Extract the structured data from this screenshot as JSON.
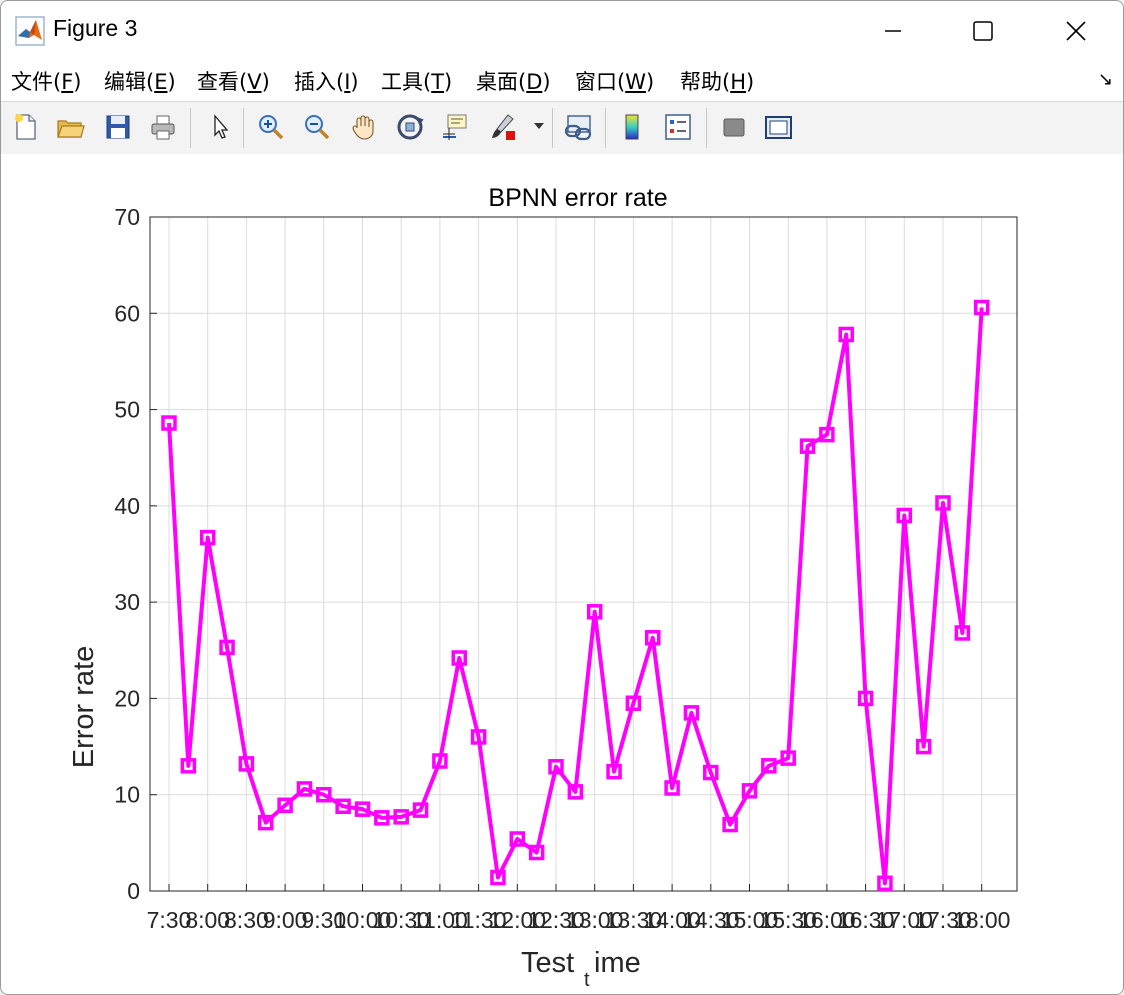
{
  "window": {
    "title": "Figure 3"
  },
  "menu": {
    "items": [
      {
        "label": "文件(",
        "key": "F",
        "tail": ")"
      },
      {
        "label": "编辑(",
        "key": "E",
        "tail": ")"
      },
      {
        "label": "查看(",
        "key": "V",
        "tail": ")"
      },
      {
        "label": "插入(",
        "key": "I",
        "tail": ")"
      },
      {
        "label": "工具(",
        "key": "T",
        "tail": ")"
      },
      {
        "label": "桌面(",
        "key": "D",
        "tail": ")"
      },
      {
        "label": "窗口(",
        "key": "W",
        "tail": ")"
      },
      {
        "label": "帮助(",
        "key": "H",
        "tail": ")"
      }
    ],
    "dock_arrow": "↘"
  },
  "toolbar": {
    "icons": [
      "new-figure-icon",
      "open-file-icon",
      "save-icon",
      "print-icon",
      "pointer-icon",
      "zoom-in-icon",
      "zoom-out-icon",
      "pan-icon",
      "rotate-3d-icon",
      "data-cursor-icon",
      "brush-icon",
      "link-plot-icon",
      "colorbar-icon",
      "legend-icon",
      "hide-plot-tools-icon",
      "show-plot-tools-icon"
    ]
  },
  "chart_data": {
    "type": "line",
    "title": "BPNN error rate",
    "xlabel_main": "Test",
    "xlabel_sub": "t",
    "xlabel_tail": "ime",
    "ylabel": "Error rate",
    "ylim": [
      0,
      70
    ],
    "yticks": [
      0,
      10,
      20,
      30,
      40,
      50,
      60,
      70
    ],
    "xticks": [
      "7:30",
      "8:00",
      "8:30",
      "9:00",
      "9:30",
      "10:00",
      "10:30",
      "11:00",
      "11:30",
      "12:00",
      "12:30",
      "13:00",
      "13:30",
      "14:00",
      "14:30",
      "15:00",
      "15:30",
      "16:00",
      "16:30",
      "17:00",
      "17:30",
      "18:00"
    ],
    "color": "#ff00ff",
    "grid": true,
    "marker": "square",
    "series": [
      {
        "values": [
          48.6,
          13.0,
          36.7,
          25.3,
          13.2,
          7.1,
          8.9,
          10.6,
          10.0,
          8.8,
          8.5,
          7.6,
          7.7,
          8.4,
          13.5,
          24.2,
          16.0,
          1.4,
          5.4,
          4.0,
          12.9,
          10.3,
          29.0,
          12.4,
          19.5,
          26.3,
          10.7,
          18.5,
          12.3,
          6.9,
          10.4,
          13.0,
          13.8,
          46.2,
          47.4,
          57.8,
          20.0,
          0.8,
          39.0,
          15.0,
          40.3,
          26.8,
          60.6
        ]
      }
    ]
  }
}
